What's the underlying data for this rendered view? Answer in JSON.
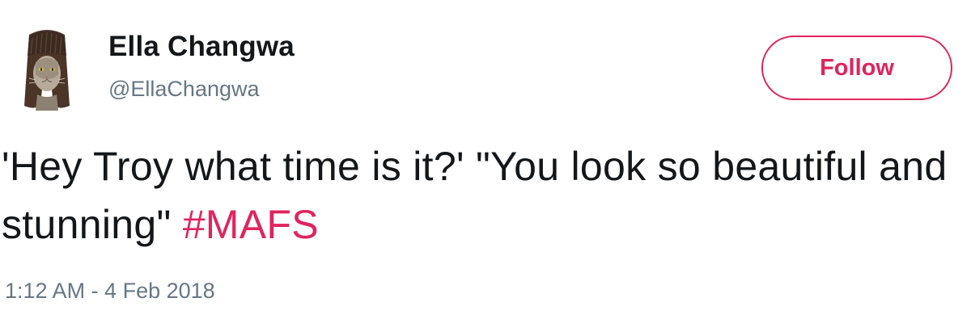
{
  "user": {
    "display_name": "Ella Changwa",
    "handle": "@EllaChangwa",
    "avatar_icon": "cat-with-wig-avatar-icon"
  },
  "follow_button": {
    "label": "Follow"
  },
  "tweet": {
    "text_part1": "'Hey Troy what time is it?' \"You look so beautiful and stunning\"",
    "hashtag": "#MAFS",
    "timestamp": "1:12 AM - 4 Feb 2018"
  },
  "colors": {
    "accent": "#e0245e",
    "text_primary": "#14171a",
    "text_secondary": "#657786"
  }
}
